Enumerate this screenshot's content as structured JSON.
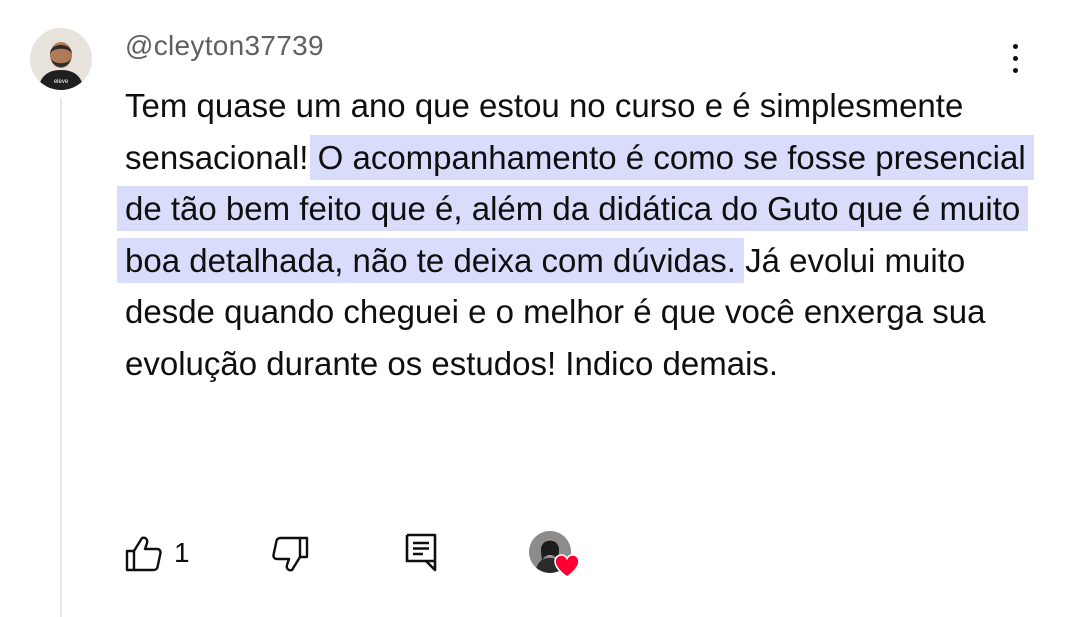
{
  "comment": {
    "author": "@cleyton37739",
    "text_before": "Tem quase um ano que estou no curso e é simplesmente sensacional! ",
    "text_highlight": "O acompanhamento é como se fosse presencial de tão bem feito que é, além da didática do Guto que é muito boa detalhada, não te deixa com dúvidas.",
    "text_after": " Já evolui muito desde quando cheguei e o melhor é que você enxerga sua evolução durante os estudos! Indico demais.",
    "avatar_shirt_text": "eleve",
    "like_count": "1"
  },
  "colors": {
    "highlight": "#d9dcfb",
    "heart": "#ff0033",
    "author_text": "#606060",
    "body_text": "#0f0f0f"
  },
  "icons": [
    "more-vert-icon",
    "thumbs-up-icon",
    "thumbs-down-icon",
    "reply-icon",
    "heart-icon"
  ]
}
